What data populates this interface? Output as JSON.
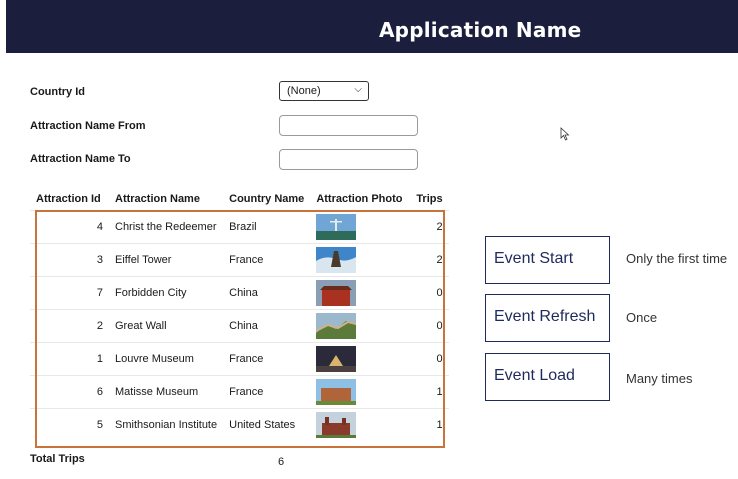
{
  "app": {
    "title": "Application Name"
  },
  "filters": {
    "country_label": "Country Id",
    "country_value": "(None)",
    "from_label": "Attraction Name From",
    "from_value": "",
    "to_label": "Attraction Name To",
    "to_value": ""
  },
  "table": {
    "headers": [
      "Attraction Id",
      "Attraction Name",
      "Country Name",
      "Attraction Photo",
      "Trips"
    ],
    "rows": [
      {
        "id": "4",
        "name": "Christ the Redeemer",
        "country": "Brazil",
        "trips": "2"
      },
      {
        "id": "3",
        "name": "Eiffel Tower",
        "country": "France",
        "trips": "2"
      },
      {
        "id": "7",
        "name": "Forbidden City",
        "country": "China",
        "trips": "0"
      },
      {
        "id": "2",
        "name": "Great Wall",
        "country": "China",
        "trips": "0"
      },
      {
        "id": "1",
        "name": "Louvre Museum",
        "country": "France",
        "trips": "0"
      },
      {
        "id": "6",
        "name": "Matisse Museum",
        "country": "France",
        "trips": "1"
      },
      {
        "id": "5",
        "name": "Smithsonian Institute",
        "country": "United States",
        "trips": "1"
      }
    ]
  },
  "totals": {
    "label": "Total Trips",
    "value": "6"
  },
  "events": [
    {
      "label": "Event Start",
      "note": "Only the first time"
    },
    {
      "label": "Event Refresh",
      "note": "Once"
    },
    {
      "label": "Event Load",
      "note": "Many times"
    }
  ],
  "colors": {
    "header_bg": "#1b1e3c",
    "highlight": "#c8733a",
    "event_border": "#1f2a5c"
  }
}
